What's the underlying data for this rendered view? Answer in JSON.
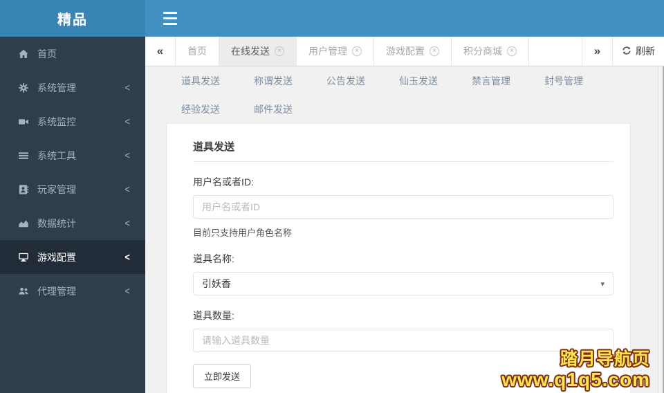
{
  "colors": {
    "logo_bg": "#3884b4",
    "navbar_bg": "#4190c1",
    "sidebar_bg": "#2f3e4d",
    "sidebar_active_bg": "#222c38",
    "active_tab_bg": "#ececec",
    "watermark_fill": "#ffe352",
    "watermark_outline": "#7b2f0e"
  },
  "brand": {
    "title": "精品"
  },
  "icons": {
    "hamburger": "hamburger-icon",
    "close": "×",
    "caret": "▾",
    "chevron_left": "<",
    "scroll_left": "«",
    "scroll_right": "»"
  },
  "sidebar": {
    "items": [
      {
        "label": "首页",
        "icon": "home-icon",
        "active": false,
        "has_children": false
      },
      {
        "label": "系统管理",
        "icon": "gear-icon",
        "active": false,
        "has_children": true
      },
      {
        "label": "系统监控",
        "icon": "video-camera-icon",
        "active": false,
        "has_children": true
      },
      {
        "label": "系统工具",
        "icon": "list-icon",
        "active": false,
        "has_children": true
      },
      {
        "label": "玩家管理",
        "icon": "address-book-icon",
        "active": false,
        "has_children": true
      },
      {
        "label": "数据统计",
        "icon": "area-chart-icon",
        "active": false,
        "has_children": true
      },
      {
        "label": "游戏配置",
        "icon": "desktop-icon",
        "active": true,
        "has_children": true
      },
      {
        "label": "代理管理",
        "icon": "users-icon",
        "active": false,
        "has_children": true
      }
    ]
  },
  "tabbar": {
    "refresh_label": "刷新",
    "tabs": [
      {
        "label": "首页",
        "closable": false,
        "active": false
      },
      {
        "label": "在线发送",
        "closable": true,
        "active": true
      },
      {
        "label": "用户管理",
        "closable": true,
        "active": false
      },
      {
        "label": "游戏配置",
        "closable": true,
        "active": false
      },
      {
        "label": "积分商城",
        "closable": true,
        "active": false
      }
    ]
  },
  "subnav": {
    "row1": [
      "道具发送",
      "称谓发送",
      "公告发送",
      "仙玉发送",
      "禁言管理",
      "封号管理"
    ],
    "row2": [
      "经验发送",
      "邮件发送"
    ]
  },
  "panel": {
    "title": "道具发送"
  },
  "form": {
    "username_label": "用户名或者ID:",
    "username_placeholder": "用户名或者ID",
    "username_hint": "目前只支持用户角色名称",
    "item_name_label": "道具名称:",
    "item_name_value": "引妖香",
    "item_count_label": "道具数量:",
    "item_count_placeholder": "请输入道具数量",
    "submit_label": "立即发送"
  },
  "watermark": {
    "line1": "踏月导航页",
    "line2": "www.q1q5.com"
  }
}
